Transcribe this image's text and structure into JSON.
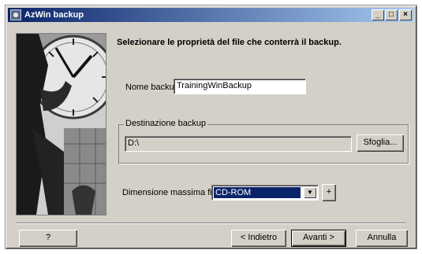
{
  "window": {
    "title": "AzWin backup",
    "controls": {
      "minimize": "_",
      "maximize": "□",
      "close": "×"
    }
  },
  "heading": "Selezionare le proprietà del file che conterrà il backup.",
  "backup_name": {
    "label": "Nome backup",
    "value": "TrainingWinBackup"
  },
  "destination": {
    "group_title": "Destinazione backup",
    "value": "D:\\",
    "browse_label": "Sfoglia..."
  },
  "max_size": {
    "label": "Dimensione massima file",
    "selected": "CD-ROM",
    "add_label": "+"
  },
  "footer": {
    "help_label": "?",
    "back_label": "< Indietro",
    "next_label": "Avanti >",
    "cancel_label": "Annulla"
  },
  "icons": {
    "app": "app-icon",
    "dropdown": "chevron-down-icon"
  }
}
